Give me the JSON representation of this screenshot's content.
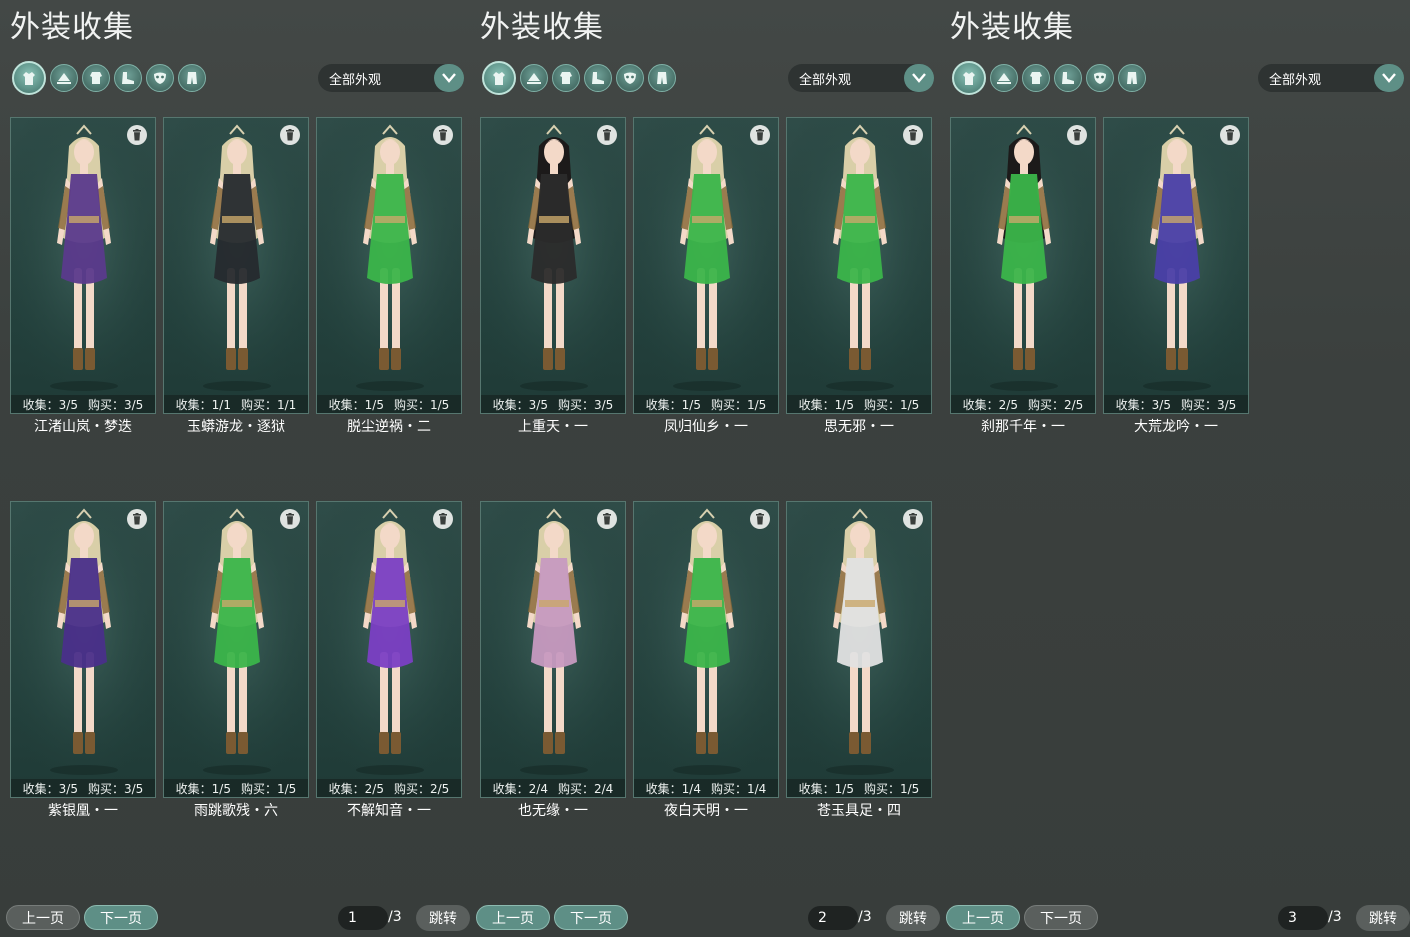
{
  "panels": [
    {
      "title": "外装收集",
      "filter": "全部外观",
      "cards": [
        {
          "name": "江渚山岚・梦迭",
          "collect": "收集：3/5",
          "buy": "购买：3/5",
          "outfit": "#5b3a8c",
          "hair": "#d9cfa8"
        },
        {
          "name": "玉蟒游龙・逐狱",
          "collect": "收集：1/1",
          "buy": "购买：1/1",
          "outfit": "#262a2e",
          "hair": "#d9cfa8"
        },
        {
          "name": "脱尘逆祸・二",
          "collect": "收集：1/5",
          "buy": "购买：1/5",
          "outfit": "#3bb54a",
          "hair": "#d9cfa8"
        },
        {
          "name": "紫银凰・一",
          "collect": "收集：3/5",
          "buy": "购买：3/5",
          "outfit": "#4a2f8a",
          "hair": "#d9cfa8"
        },
        {
          "name": "雨跳歌残・六",
          "collect": "收集：1/5",
          "buy": "购买：1/5",
          "outfit": "#3bb54a",
          "hair": "#d9cfa8"
        },
        {
          "name": "不解知音・一",
          "collect": "收集：2/5",
          "buy": "购买：2/5",
          "outfit": "#7b3fc4",
          "hair": "#d9cfa8"
        }
      ],
      "pager": {
        "prev": "上一页",
        "next": "下一页",
        "page": "1",
        "total": "/3",
        "jump": "跳转"
      }
    },
    {
      "title": "外装收集",
      "filter": "全部外观",
      "cards": [
        {
          "name": "上重天・一",
          "collect": "收集：3/5",
          "buy": "购买：3/5",
          "outfit": "#2b2b2b",
          "hair": "#1c1a1a"
        },
        {
          "name": "凤归仙乡・一",
          "collect": "收集：1/5",
          "buy": "购买：1/5",
          "outfit": "#3bb54a",
          "hair": "#d9cfa8"
        },
        {
          "name": "思无邪・一",
          "collect": "收集：1/5",
          "buy": "购买：1/5",
          "outfit": "#3bb54a",
          "hair": "#d9cfa8"
        },
        {
          "name": "也无缘・一",
          "collect": "收集：2/4",
          "buy": "购买：2/4",
          "outfit": "#c79ac0",
          "hair": "#d9cfa8"
        },
        {
          "name": "夜白天明・一",
          "collect": "收集：1/4",
          "buy": "购买：1/4",
          "outfit": "#3bb54a",
          "hair": "#d9cfa8"
        },
        {
          "name": "苍玉具足・四",
          "collect": "收集：1/5",
          "buy": "购买：1/5",
          "outfit": "#e2e2e2",
          "hair": "#d9cfa8"
        }
      ],
      "pager": {
        "prev": "上一页",
        "next": "下一页",
        "page": "2",
        "total": "/3",
        "jump": "跳转"
      }
    },
    {
      "title": "外装收集",
      "filter": "全部外观",
      "cards": [
        {
          "name": "刹那千年・一",
          "collect": "收集：2/5",
          "buy": "购买：2/5",
          "outfit": "#3bb54a",
          "hair": "#1c1a1a"
        },
        {
          "name": "大荒龙吟・一",
          "collect": "收集：3/5",
          "buy": "购买：3/5",
          "outfit": "#4a3fa8",
          "hair": "#d9cfa8"
        }
      ],
      "pager": {
        "prev": "上一页",
        "next": "下一页",
        "page": "3",
        "total": "/3",
        "jump": "跳转"
      }
    }
  ],
  "category_icons": [
    "outfit-icon",
    "hat-icon",
    "top-icon",
    "shoe-icon",
    "mask-icon",
    "pants-icon"
  ],
  "colors": {
    "accent": "#5e8f86",
    "card_bg": "#2a4743",
    "panel_bg": "#3f4442"
  }
}
